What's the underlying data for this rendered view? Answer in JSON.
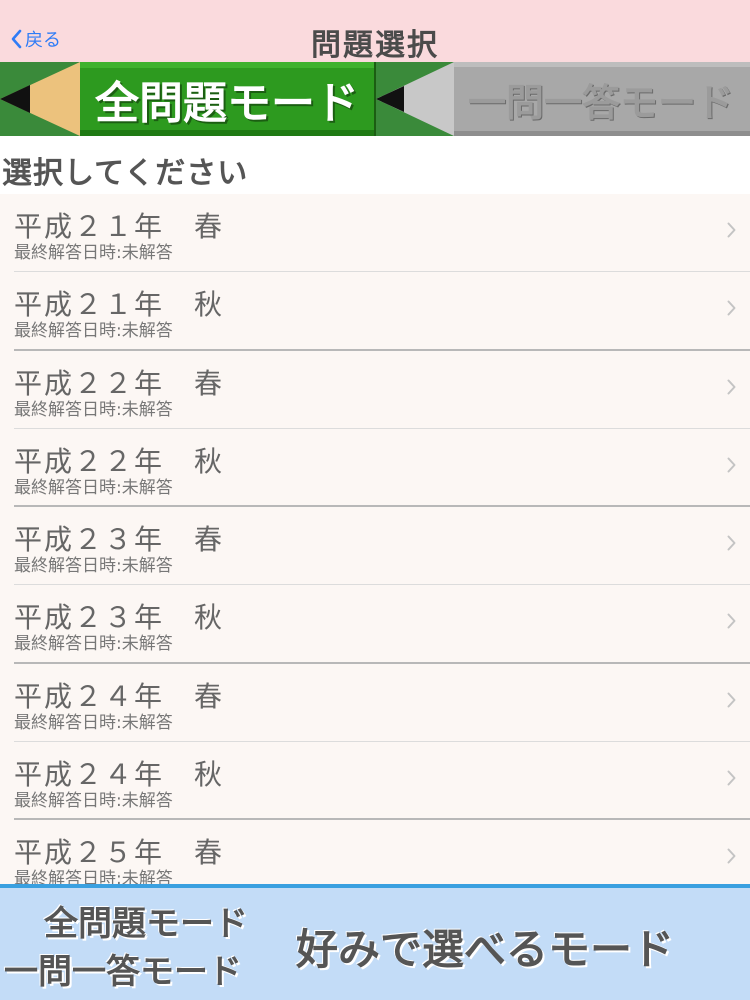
{
  "nav": {
    "back_label": "戻る",
    "title": "問題選択"
  },
  "tabs": {
    "all_label": "全問題モード",
    "one_label": "一問一答モード",
    "active": "all"
  },
  "section": {
    "title": "選択してください"
  },
  "list": {
    "items": [
      {
        "title": "平成２１年　春",
        "subtitle": "最終解答日時:未解答"
      },
      {
        "title": "平成２１年　秋",
        "subtitle": "最終解答日時:未解答"
      },
      {
        "title": "平成２２年　春",
        "subtitle": "最終解答日時:未解答"
      },
      {
        "title": "平成２２年　秋",
        "subtitle": "最終解答日時:未解答"
      },
      {
        "title": "平成２３年　春",
        "subtitle": "最終解答日時:未解答"
      },
      {
        "title": "平成２３年　秋",
        "subtitle": "最終解答日時:未解答"
      },
      {
        "title": "平成２４年　春",
        "subtitle": "最終解答日時:未解答"
      },
      {
        "title": "平成２４年　秋",
        "subtitle": "最終解答日時:未解答"
      },
      {
        "title": "平成２５年　春",
        "subtitle": "最終解答日時:未解答"
      }
    ]
  },
  "banner": {
    "line1": "全問題モード",
    "line2": "一問一答モード",
    "tagline": "好みで選べるモード"
  },
  "colors": {
    "navbar_bg": "#fadadd",
    "back_blue": "#2f7cf6",
    "active_tab_green": "#2d9a1f",
    "inactive_tab_gray": "#a8a8a8",
    "banner_bg": "#c3dcf7",
    "banner_line": "#3aa0e0"
  },
  "icons": {
    "back": "chevron-left-icon",
    "row": "chevron-right-icon",
    "tab": "pencil-icon"
  }
}
